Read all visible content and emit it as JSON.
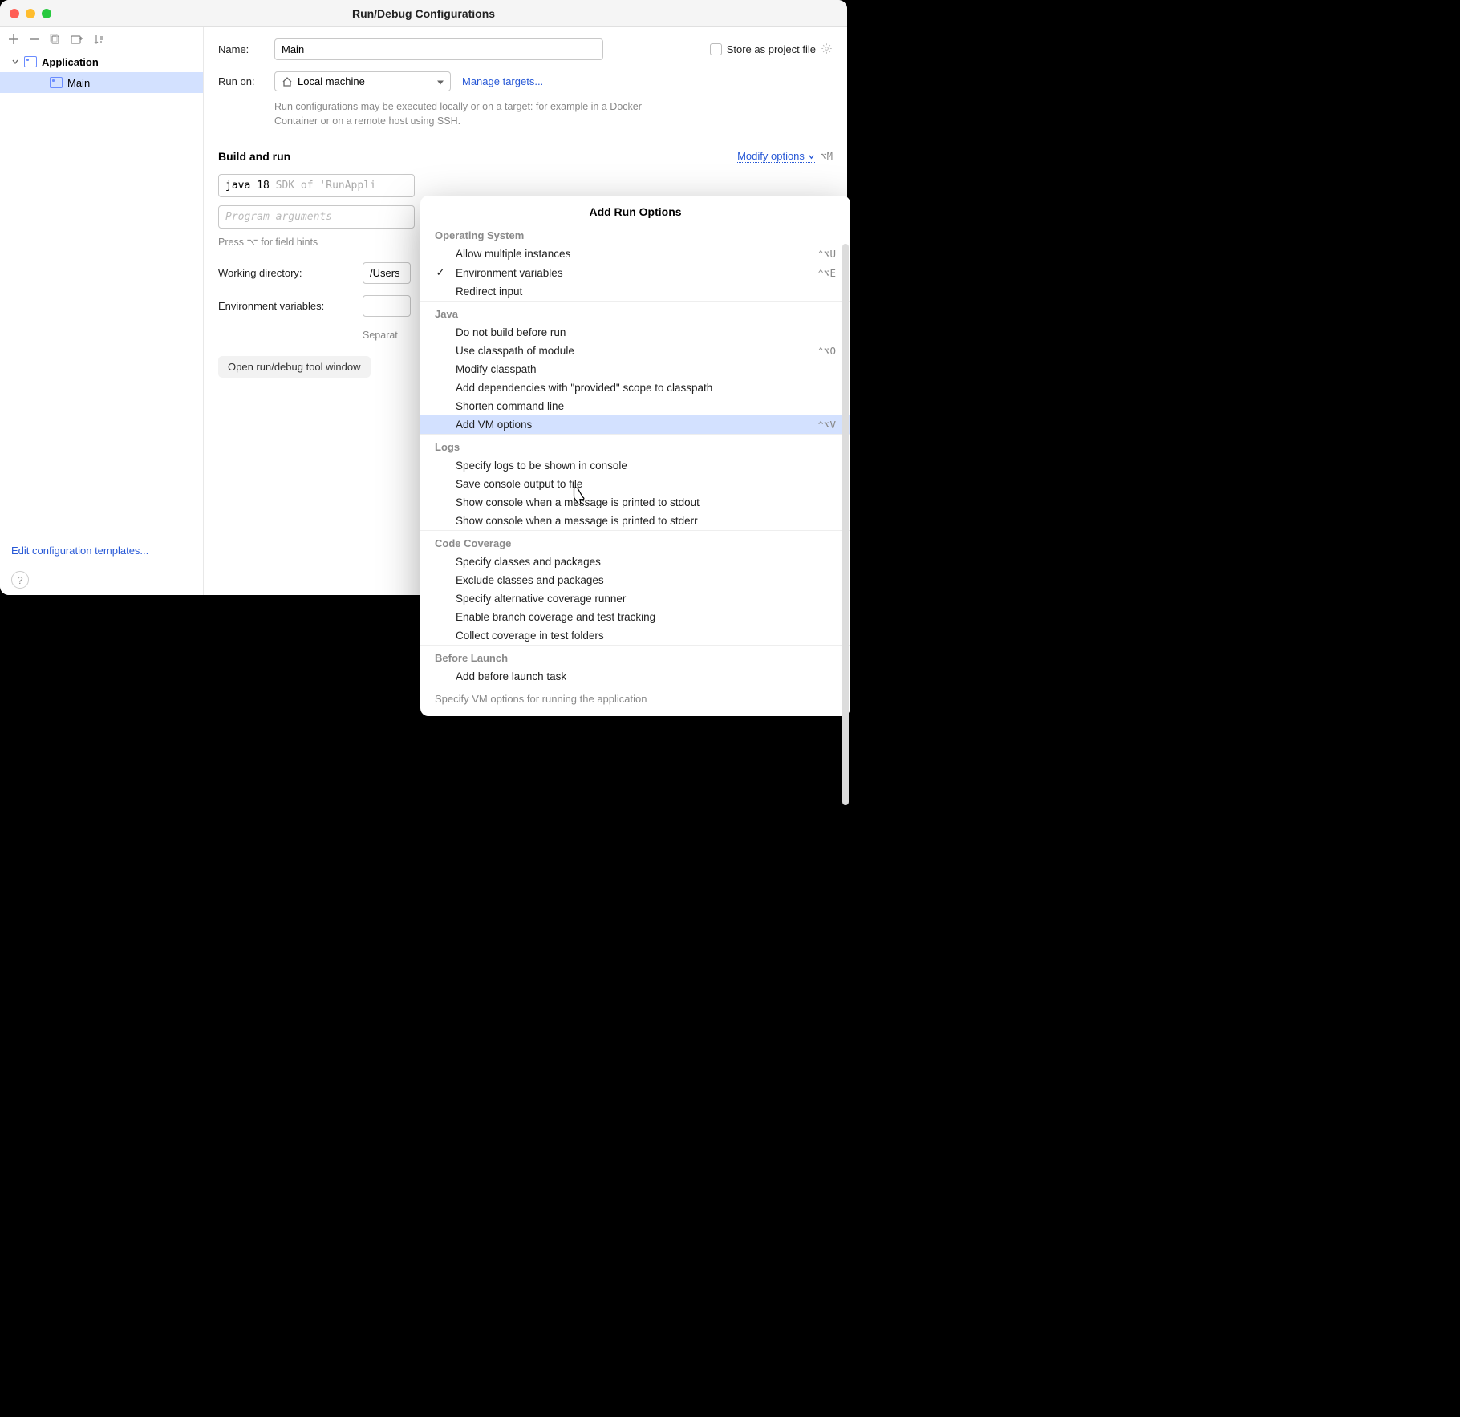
{
  "window": {
    "title": "Run/Debug Configurations"
  },
  "sidebar": {
    "root": "Application",
    "items": [
      "Main"
    ],
    "footer_link": "Edit configuration templates..."
  },
  "form": {
    "name_label": "Name:",
    "name_value": "Main",
    "store_as_file": "Store as project file",
    "run_on_label": "Run on:",
    "run_on_value": "Local machine",
    "manage_targets": "Manage targets...",
    "run_on_hint": "Run configurations may be executed locally or on a target: for example in a Docker Container or on a remote host using SSH.",
    "build_run": "Build and run",
    "modify_options": "Modify options",
    "modify_shortcut": "⌥M",
    "sdk_prefix": "java 18",
    "sdk_suffix": "SDK of 'RunAppli",
    "program_args_placeholder": "Program arguments",
    "field_hints": "Press ⌥ for field hints",
    "working_dir_label": "Working directory:",
    "working_dir_value": "/Users",
    "env_label": "Environment variables:",
    "env_hint": "Separat",
    "open_tool_window": "Open run/debug tool window "
  },
  "popup": {
    "title": "Add Run Options",
    "groups": [
      {
        "name": "Operating System",
        "items": [
          {
            "label": "Allow multiple instances",
            "shortcut": "⌃⌥U",
            "checked": false
          },
          {
            "label": "Environment variables",
            "shortcut": "⌃⌥E",
            "checked": true
          },
          {
            "label": "Redirect input",
            "shortcut": "",
            "checked": false
          }
        ]
      },
      {
        "name": "Java",
        "items": [
          {
            "label": "Do not build before run",
            "shortcut": "",
            "checked": false
          },
          {
            "label": "Use classpath of module",
            "shortcut": "⌃⌥O",
            "checked": false
          },
          {
            "label": "Modify classpath",
            "shortcut": "",
            "checked": false
          },
          {
            "label": "Add dependencies with \"provided\" scope to classpath",
            "shortcut": "",
            "checked": false
          },
          {
            "label": "Shorten command line",
            "shortcut": "",
            "checked": false
          },
          {
            "label": "Add VM options",
            "shortcut": "⌃⌥V",
            "checked": false,
            "selected": true
          }
        ]
      },
      {
        "name": "Logs",
        "items": [
          {
            "label": "Specify logs to be shown in console",
            "shortcut": "",
            "checked": false
          },
          {
            "label": "Save console output to file",
            "shortcut": "",
            "checked": false
          },
          {
            "label": "Show console when a message is printed to stdout",
            "shortcut": "",
            "checked": false
          },
          {
            "label": "Show console when a message is printed to stderr",
            "shortcut": "",
            "checked": false
          }
        ]
      },
      {
        "name": "Code Coverage",
        "items": [
          {
            "label": "Specify classes and packages",
            "shortcut": "",
            "checked": false
          },
          {
            "label": "Exclude classes and packages",
            "shortcut": "",
            "checked": false
          },
          {
            "label": "Specify alternative coverage runner",
            "shortcut": "",
            "checked": false
          },
          {
            "label": "Enable branch coverage and test tracking",
            "shortcut": "",
            "checked": false
          },
          {
            "label": "Collect coverage in test folders",
            "shortcut": "",
            "checked": false
          }
        ]
      },
      {
        "name": "Before Launch",
        "items": [
          {
            "label": "Add before launch task",
            "shortcut": "",
            "checked": false
          }
        ]
      }
    ],
    "footer": "Specify VM options for running the application"
  }
}
